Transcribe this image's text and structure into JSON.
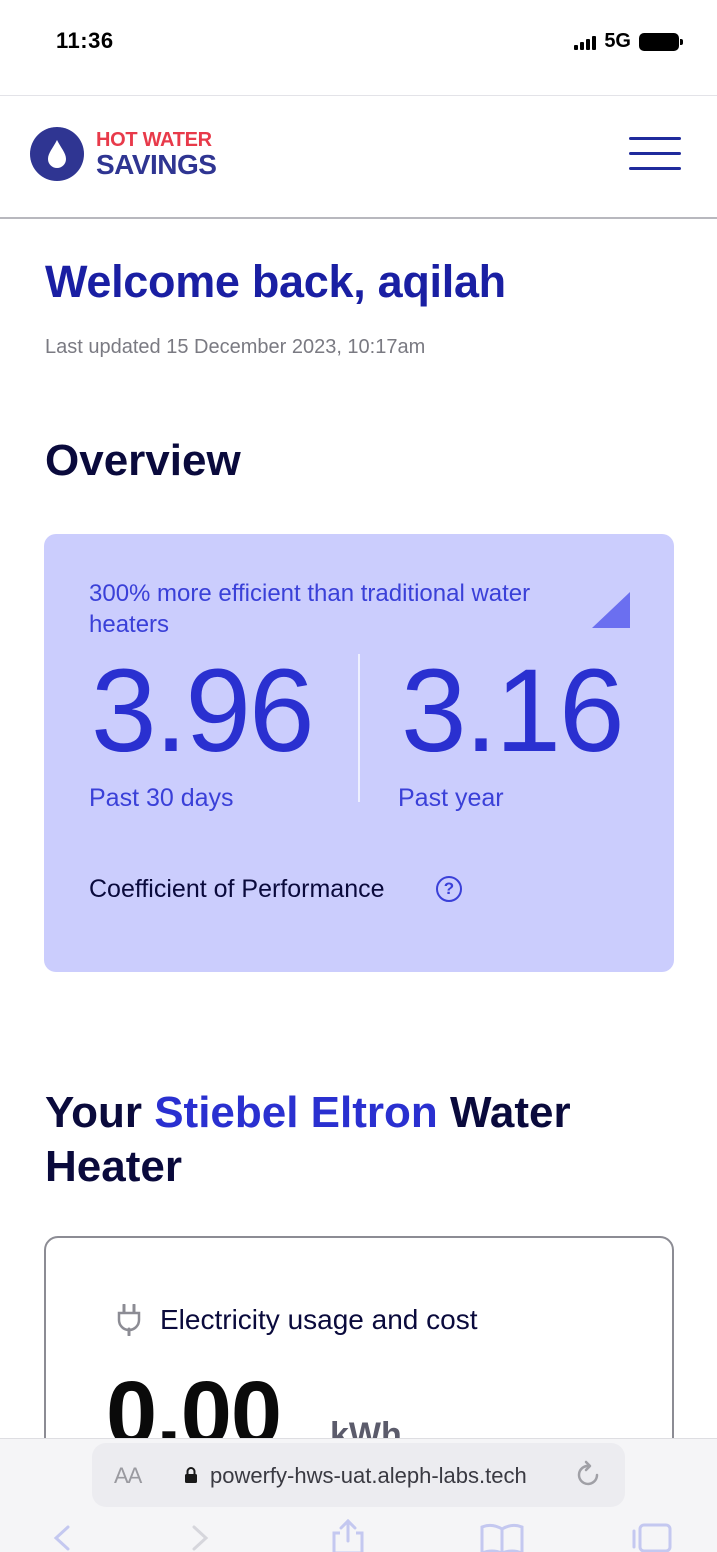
{
  "status_bar": {
    "time": "11:36",
    "network": "5G"
  },
  "header": {
    "logo_line1": "HOT WATER",
    "logo_line2": "SAVINGS",
    "menu_icon": "hamburger-menu-icon"
  },
  "main": {
    "welcome": "Welcome back, aqilah",
    "last_updated": "Last updated 15 December 2023, 10:17am",
    "overview_title": "Overview",
    "cop_card": {
      "efficiency_text": "300% more efficient than traditional water heaters",
      "value_30_days": "3.96",
      "label_30_days": "Past 30 days",
      "value_year": "3.16",
      "label_year": "Past year",
      "metric_label": "Coefficient of Performance",
      "help_icon": "question-circle-icon",
      "help_glyph": "?"
    },
    "heater": {
      "title_prefix": "Your ",
      "brand": "Stiebel Eltron",
      "title_suffix": " Water Heater"
    },
    "usage_card": {
      "icon": "plug-icon",
      "title": "Electricity usage and cost",
      "value": "0.00",
      "unit": "kWh"
    }
  },
  "browser": {
    "text_size": "AA",
    "url": "powerfy-hws-uat.aleph-labs.tech"
  },
  "colors": {
    "brand_blue": "#1a1fa3",
    "accent_blue": "#2a30d0",
    "card_lavender": "#cbcdfd",
    "logo_red": "#e83a4a"
  }
}
